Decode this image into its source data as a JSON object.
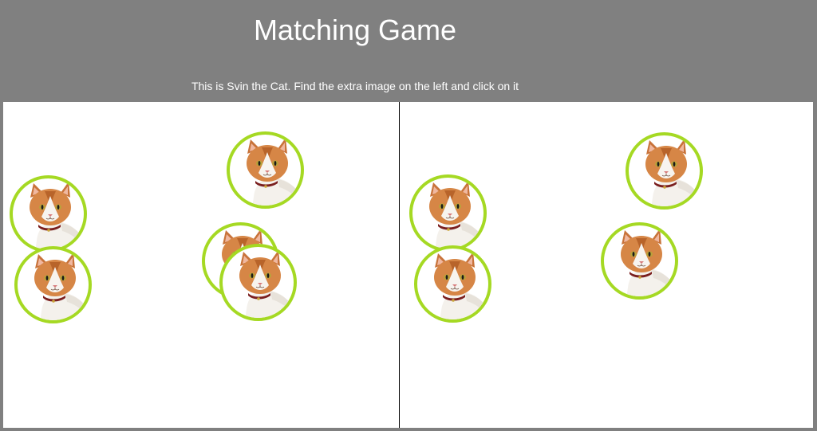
{
  "header": {
    "title": "Matching Game",
    "instructions": "This is Svin the Cat. Find the extra image on the left and click on it"
  },
  "token": {
    "ring_color": "#a5d923",
    "icon": "cat-face-icon"
  },
  "left_board": {
    "cat_count": 5
  },
  "right_board": {
    "cat_count": 4
  }
}
